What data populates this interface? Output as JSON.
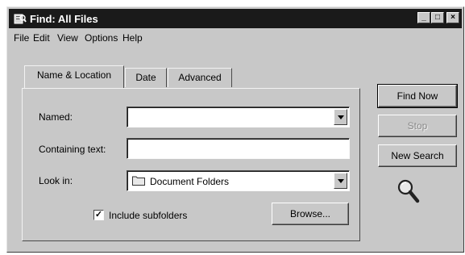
{
  "window": {
    "title": "Find: All Files",
    "controls": {
      "minimize": "_",
      "maximize": "□",
      "close": "×"
    }
  },
  "menu": [
    "File",
    "Edit",
    "View",
    "Options",
    "Help"
  ],
  "tabs": [
    {
      "label": "Name & Location",
      "active": true
    },
    {
      "label": "Date",
      "active": false
    },
    {
      "label": "Advanced",
      "active": false
    }
  ],
  "form": {
    "named_label": "Named:",
    "named_value": "",
    "containing_label": "Containing text:",
    "containing_value": "",
    "lookin_label": "Look in:",
    "lookin_value": "Document Folders",
    "include_subfolders_label": "Include subfolders",
    "include_subfolders_checked": true,
    "checkbox_mark": "✓",
    "browse_label": "Browse..."
  },
  "buttons": {
    "find_now": "Find Now",
    "stop": "Stop",
    "new_search": "New Search"
  },
  "icons": {
    "title": "find-window-icon",
    "search": "magnifier-icon",
    "folder": "folder-icon"
  },
  "colors": {
    "window_bg": "#c8c8c8",
    "titlebar_bg": "#1a1a1a"
  }
}
